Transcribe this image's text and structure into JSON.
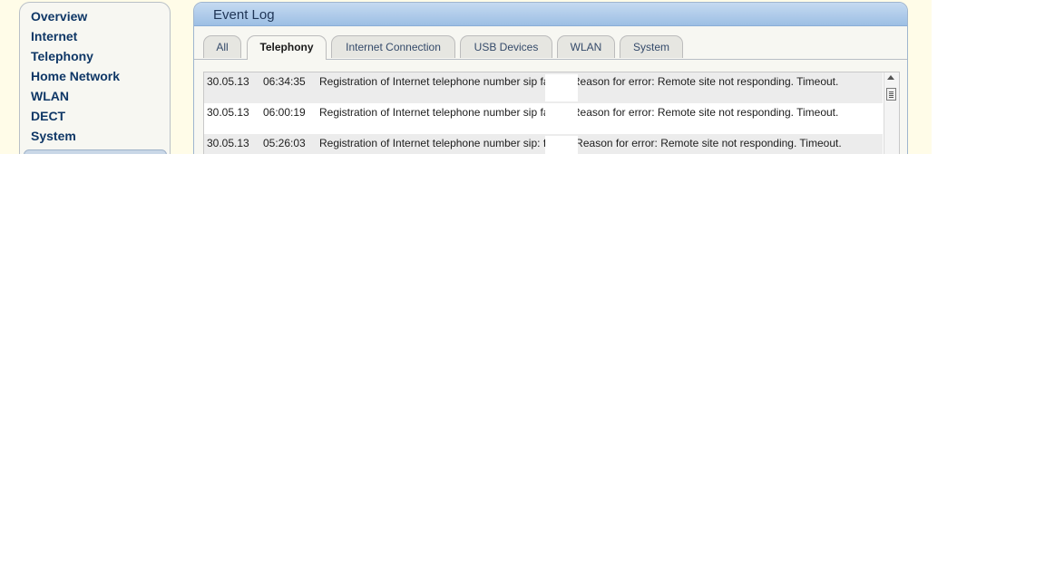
{
  "sidebar": {
    "items": [
      {
        "label": "Overview"
      },
      {
        "label": "Internet"
      },
      {
        "label": "Telephony"
      },
      {
        "label": "Home Network"
      },
      {
        "label": "WLAN"
      },
      {
        "label": "DECT"
      },
      {
        "label": "System"
      }
    ]
  },
  "panel": {
    "title": "Event Log",
    "tabs": [
      {
        "label": "All",
        "active": false
      },
      {
        "label": "Telephony",
        "active": true
      },
      {
        "label": "Internet Connection",
        "active": false
      },
      {
        "label": "USB Devices",
        "active": false
      },
      {
        "label": "WLAN",
        "active": false
      },
      {
        "label": "System",
        "active": false
      }
    ]
  },
  "log": {
    "entries": [
      {
        "date": "30.05.13",
        "time": "06:34:35",
        "message_start": "Registration of Internet telephone number sip",
        "message_end": "failed. Reason for error: Remote site not responding. Timeout."
      },
      {
        "date": "30.05.13",
        "time": "06:00:19",
        "message_start": "Registration of Internet telephone number sip",
        "message_end": "failed. Reason for error: Remote site not responding. Timeout."
      },
      {
        "date": "30.05.13",
        "time": "05:26:03",
        "message_start": "Registration of Internet telephone number sip:",
        "message_end": "failed. Reason for error: Remote site not responding. Timeout."
      }
    ]
  },
  "colors": {
    "page_background": "#fffce8",
    "nav_text": "#0f3766",
    "header_gradient_top": "#c5daf1",
    "header_gradient_bottom": "#9dbfe4",
    "row_alt": "#ececec"
  },
  "icons": [
    "scroll-up-arrow-icon",
    "scroll-thumb-grip-icon"
  ]
}
